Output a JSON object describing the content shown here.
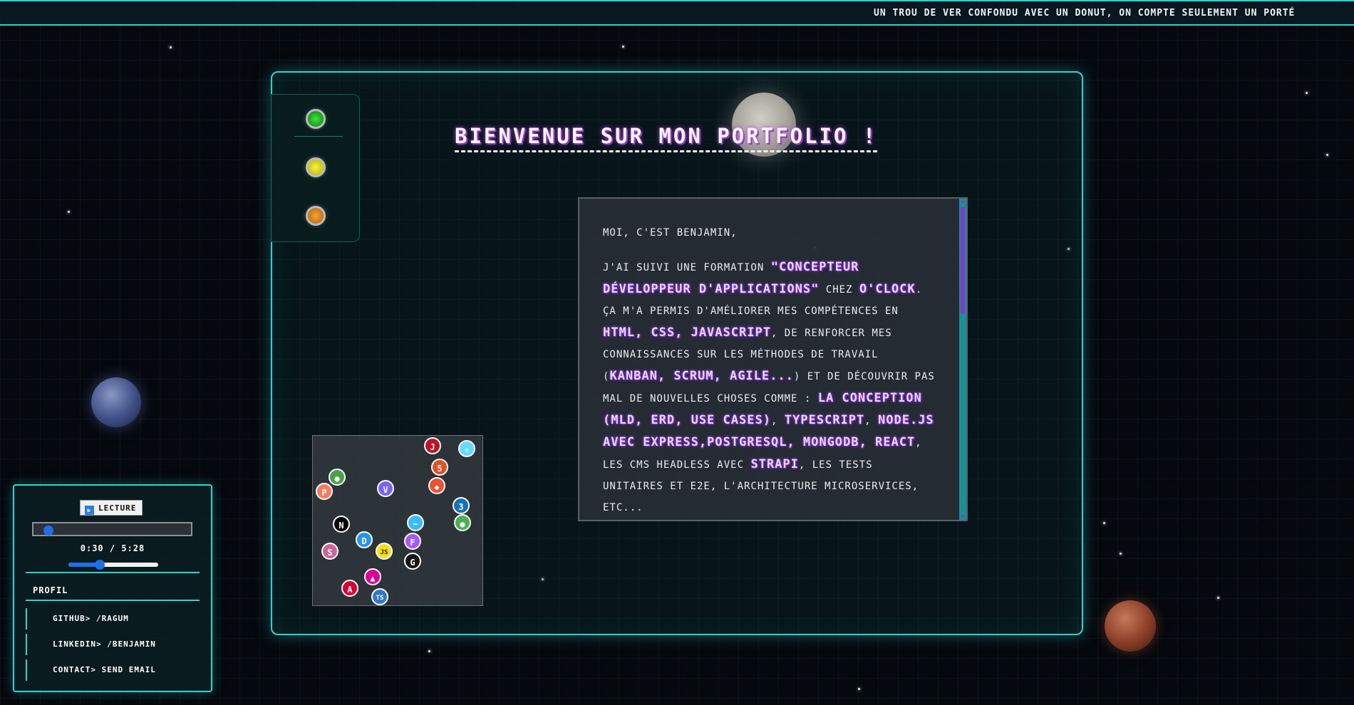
{
  "marquee": {
    "text": "UN TROU DE VER CONFONDU AVEC UN DONUT, ON COMPTE SEULEMENT UN PORTÉ"
  },
  "header": {
    "title": "BIENVENUE SUR MON PORTFOLIO !"
  },
  "window_lights": [
    "green",
    "yellow",
    "orange"
  ],
  "about": {
    "greeting": "MOI, C'EST BENJAMIN,",
    "p2_a": "J'AI SUIVI UNE FORMATION ",
    "p2_hl1": "\"CONCEPTEUR DÉVELOPPEUR D'APPLICATIONS\"",
    "p2_b": " CHEZ ",
    "p2_hl2": "O'CLOCK",
    "p2_c": ". ÇA M'A PERMIS D'AMÉLIORER MES COMPÉTENCES EN ",
    "p2_hl3": "HTML, CSS, JAVASCRIPT",
    "p2_d": ", DE RENFORCER MES CONNAISSANCES SUR LES MÉTHODES DE TRAVAIL (",
    "p2_hl4": "KANBAN, SCRUM, AGILE...",
    "p2_e": ") ET DE DÉCOUVRIR PAS MAL DE NOUVELLES CHOSES COMME : ",
    "p2_hl5": "LA CONCEPTION (MLD, ERD, USE CASES)",
    "p2_f": ", ",
    "p2_hl6": "TYPESCRIPT",
    "p2_g": ", ",
    "p2_hl7": "NODE.JS AVEC EXPRESS,POSTGRESQL, MONGODB, REACT",
    "p2_h": ", LES CMS HEADLESS AVEC ",
    "p2_hl8": "STRAPI",
    "p2_i": ", LES TESTS UNITAIRES ET E2E, L'ARCHITECTURE MICROSERVICES, ETC..."
  },
  "tech_icons": [
    {
      "name": "jest-icon",
      "glyph": "J",
      "color": "#c21325"
    },
    {
      "name": "react-icon",
      "glyph": "⚛",
      "color": "#61dafb"
    },
    {
      "name": "html5-icon",
      "glyph": "5",
      "color": "#e34f26"
    },
    {
      "name": "mongodb-icon",
      "glyph": "●",
      "color": "#47a248"
    },
    {
      "name": "vite-icon",
      "glyph": "V",
      "color": "#7b61ff"
    },
    {
      "name": "git-icon",
      "glyph": "◆",
      "color": "#f05032"
    },
    {
      "name": "postgresql-icon",
      "glyph": "P",
      "color": "#f57c60"
    },
    {
      "name": "css3-icon",
      "glyph": "3",
      "color": "#1572b6"
    },
    {
      "name": "nodejs-icon",
      "glyph": "●",
      "color": "#4caf50"
    },
    {
      "name": "nextjs-icon",
      "glyph": "N",
      "color": "#000000"
    },
    {
      "name": "tailwind-icon",
      "glyph": "~",
      "color": "#38bdf8"
    },
    {
      "name": "docker-icon",
      "glyph": "D",
      "color": "#2496ed"
    },
    {
      "name": "figma-icon",
      "glyph": "F",
      "color": "#a259ff"
    },
    {
      "name": "sass-icon",
      "glyph": "S",
      "color": "#cc6699"
    },
    {
      "name": "javascript-icon",
      "glyph": "JS",
      "color": "#f7df1e"
    },
    {
      "name": "github-icon",
      "glyph": "G",
      "color": "#181717"
    },
    {
      "name": "graphql-icon",
      "glyph": "▲",
      "color": "#e10098"
    },
    {
      "name": "angular-icon",
      "glyph": "A",
      "color": "#dd0031"
    },
    {
      "name": "typescript-icon",
      "glyph": "TS",
      "color": "#3178c6"
    }
  ],
  "player": {
    "play_label": "LECTURE",
    "progress": 0.095,
    "time_text": "0:30 / 5:28",
    "volume": 0.35
  },
  "profile": {
    "title": "PROFIL",
    "links": [
      "GITHUB> /RAGUM",
      "LINKEDIN> /BENJAMIN",
      "CONTACT> SEND EMAIL"
    ]
  }
}
